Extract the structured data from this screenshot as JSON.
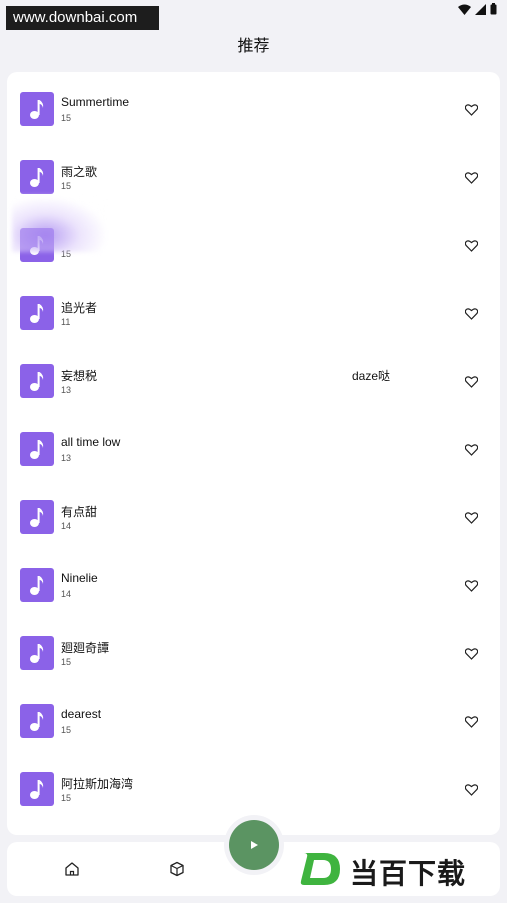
{
  "status_bar": {
    "time": "",
    "icons": [
      "wifi-icon",
      "signal-icon",
      "battery-icon"
    ]
  },
  "watermark": {
    "text": "www.downbai.com"
  },
  "header": {
    "title": "推荐"
  },
  "songs": [
    {
      "title": "Summertime",
      "count": "15",
      "artist": ""
    },
    {
      "title": "雨之歌",
      "count": "15",
      "artist": ""
    },
    {
      "title": "",
      "count": "15",
      "artist": ""
    },
    {
      "title": "追光者",
      "count": "11",
      "artist": ""
    },
    {
      "title": "妄想税",
      "count": "13",
      "artist": "daze哒"
    },
    {
      "title": "all time low",
      "count": "13",
      "artist": ""
    },
    {
      "title": "有点甜",
      "count": "14",
      "artist": ""
    },
    {
      "title": "Ninelie",
      "count": "14",
      "artist": ""
    },
    {
      "title": "廻廻奇譚",
      "count": "15",
      "artist": ""
    },
    {
      "title": "dearest",
      "count": "15",
      "artist": ""
    },
    {
      "title": "阿拉斯加海湾",
      "count": "15",
      "artist": ""
    }
  ],
  "colors": {
    "cover": "#8b62e8",
    "play_button": "#5b9462",
    "background": "#f2f2f6",
    "logo_green": "#3fb43f"
  },
  "bottom_nav": {
    "items": [
      "home-icon",
      "cube-icon"
    ],
    "play": "play-icon"
  },
  "logo_watermark": {
    "letter": "D",
    "text": "当百下载"
  }
}
